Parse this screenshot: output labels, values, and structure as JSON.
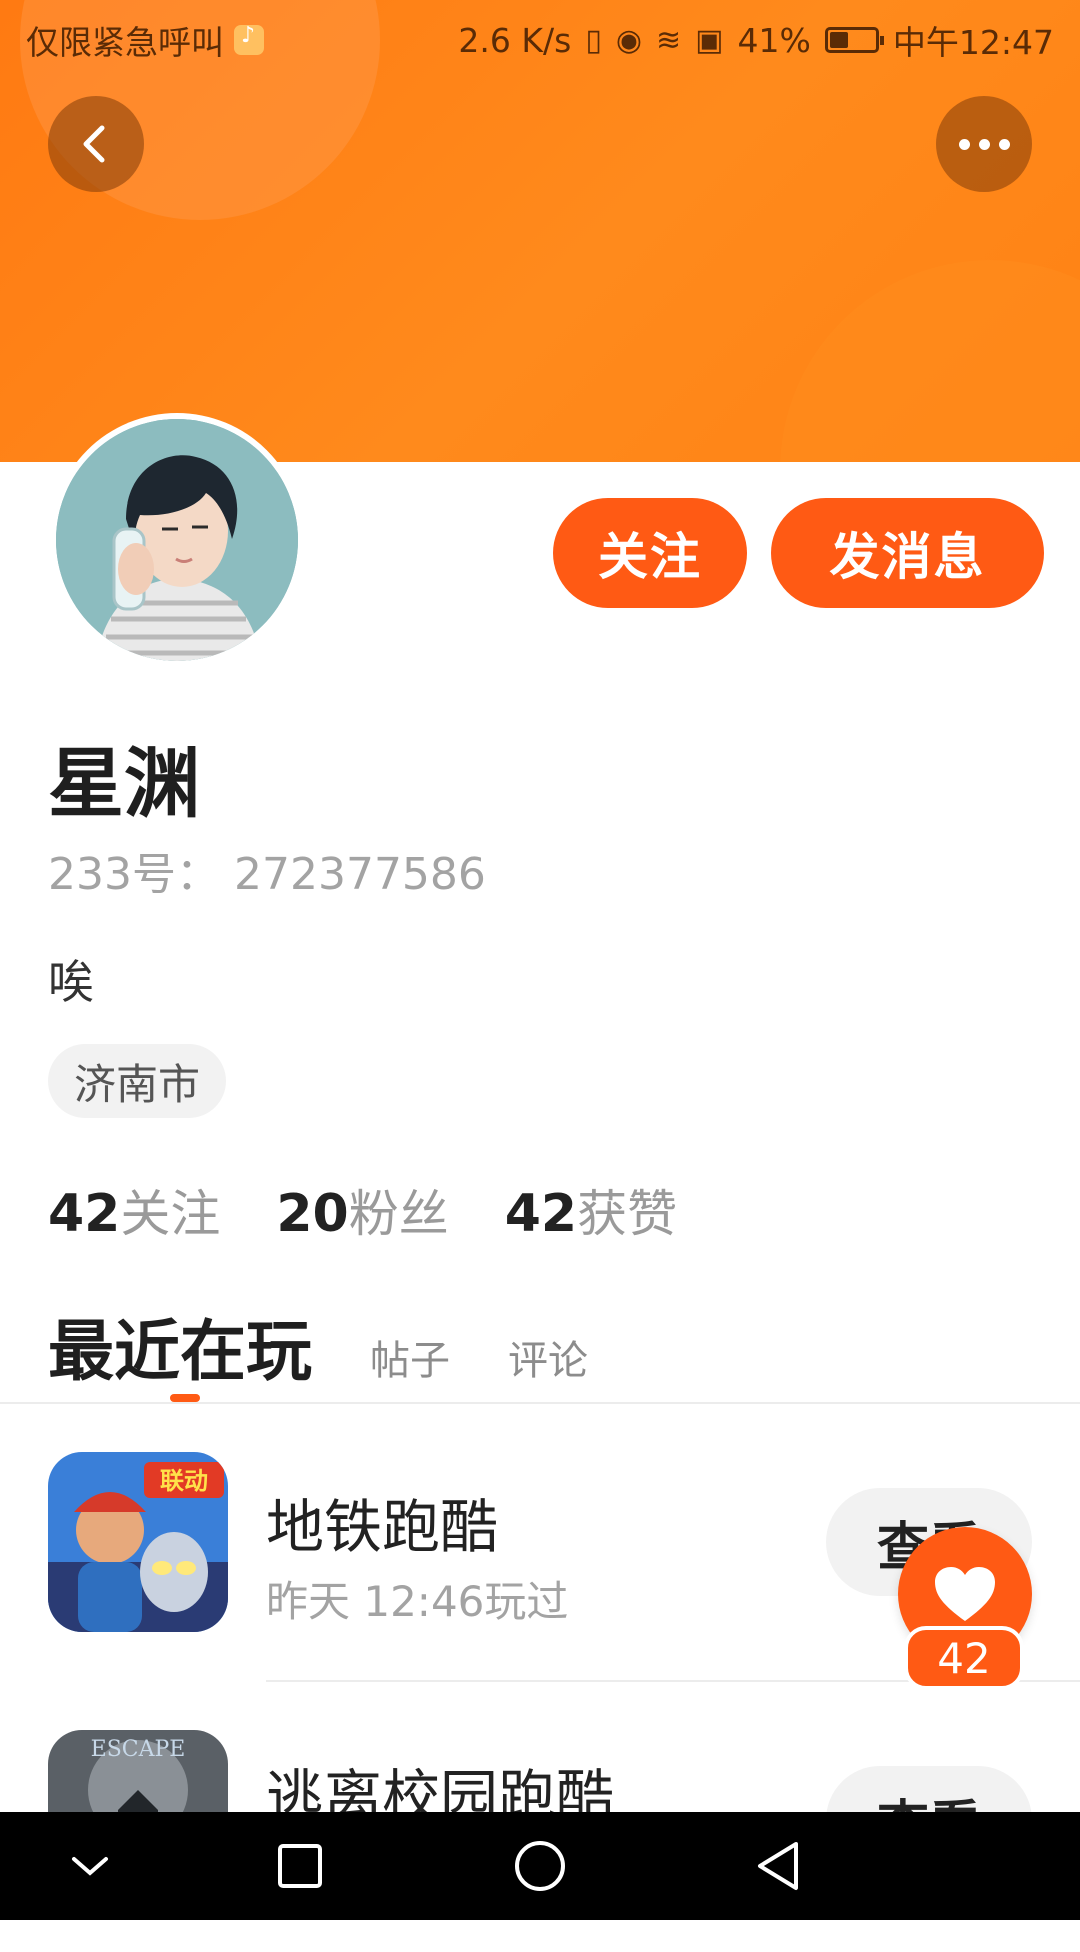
{
  "status_bar": {
    "carrier": "仅限紧急呼叫",
    "speed": "2.6 K/s",
    "battery_percent": "41%",
    "battery_level": 0.41,
    "time": "中午12:47"
  },
  "profile": {
    "name": "星渊",
    "uid_text": "233号： 272377586",
    "bio": "唉",
    "location": "济南市",
    "follow_label": "关注",
    "message_label": "发消息"
  },
  "stats": [
    {
      "num": "42",
      "label": "关注"
    },
    {
      "num": "20",
      "label": "粉丝"
    },
    {
      "num": "42",
      "label": "获赞"
    }
  ],
  "tabs": {
    "active": "最近在玩",
    "posts": "帖子",
    "comments": "评论"
  },
  "games": [
    {
      "name": "地铁跑酷",
      "time": "昨天 12:46玩过",
      "action": "查看",
      "icon_badge": "联动"
    },
    {
      "name": "逃离校园跑酷",
      "time": "",
      "action": "查看",
      "icon_badge": "ESCAPE"
    }
  ],
  "like": {
    "count": "42"
  },
  "colors": {
    "accent": "#ff5a14",
    "header": "#ff8214",
    "muted": "#a3a3a3"
  }
}
